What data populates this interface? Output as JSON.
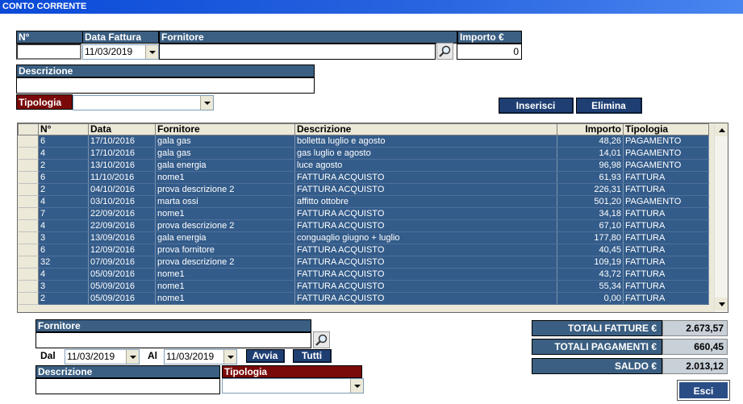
{
  "window": {
    "title": "CONTO CORRENTE"
  },
  "form": {
    "n_label": "N°",
    "n_value": "",
    "data_fattura_label": "Data Fattura",
    "data_fattura_value": "11/03/2019",
    "fornitore_label": "Fornitore",
    "fornitore_value": "",
    "importo_label": "Importo €",
    "importo_value": "0",
    "descrizione_label": "Descrizione",
    "descrizione_value": "",
    "tipologia_label": "Tipologia",
    "tipologia_value": ""
  },
  "actions": {
    "inserisci": "Inserisci",
    "elimina": "Elimina",
    "esci": "Esci"
  },
  "table": {
    "columns": [
      "N°",
      "Data",
      "Fornitore",
      "Descrizione",
      "Importo",
      "Tipologia"
    ],
    "rows": [
      [
        "6",
        "17/10/2016",
        "gala gas",
        "bolletta luglio e agosto",
        "48,26",
        "PAGAMENTO"
      ],
      [
        "4",
        "17/10/2016",
        "gala gas",
        "gas luglio e agosto",
        "14,01",
        "PAGAMENTO"
      ],
      [
        "2",
        "13/10/2016",
        "gala energia",
        "luce agosto",
        "96,98",
        "PAGAMENTO"
      ],
      [
        "6",
        "11/10/2016",
        "nome1",
        "FATTURA ACQUISTO",
        "61,93",
        "FATTURA"
      ],
      [
        "2",
        "04/10/2016",
        "prova descrizione 2",
        "FATTURA ACQUISTO",
        "226,31",
        "FATTURA"
      ],
      [
        "4",
        "03/10/2016",
        "marta ossi",
        "affitto ottobre",
        "501,20",
        "PAGAMENTO"
      ],
      [
        "7",
        "22/09/2016",
        "nome1",
        "FATTURA ACQUISTO",
        "34,18",
        "FATTURA"
      ],
      [
        "4",
        "22/09/2016",
        "prova descrizione 2",
        "FATTURA ACQUISTO",
        "67,10",
        "FATTURA"
      ],
      [
        "3",
        "13/09/2016",
        "gala energia",
        "conguaglio giugno + luglio",
        "177,80",
        "FATTURA"
      ],
      [
        "6",
        "12/09/2016",
        "prova fornitore",
        "FATTURA ACQUISTO",
        "40,45",
        "FATTURA"
      ],
      [
        "32",
        "07/09/2016",
        "prova descrizione 2",
        "FATTURA ACQUISTO",
        "109,19",
        "FATTURA"
      ],
      [
        "4",
        "05/09/2016",
        "nome1",
        "FATTURA ACQUISTO",
        "43,72",
        "FATTURA"
      ],
      [
        "3",
        "05/09/2016",
        "nome1",
        "FATTURA ACQUISTO",
        "55,34",
        "FATTURA"
      ],
      [
        "2",
        "05/09/2016",
        "nome1",
        "FATTURA ACQUISTO",
        "0,00",
        "FATTURA"
      ]
    ]
  },
  "filter": {
    "fornitore_label": "Fornitore",
    "fornitore_value": "",
    "dal_label": "Dal",
    "dal_value": "11/03/2019",
    "al_label": "Al",
    "al_value": "11/03/2019",
    "avvia": "Avvia",
    "tutti": "Tutti",
    "descrizione_label": "Descrizione",
    "descrizione_value": "",
    "tipologia_label": "Tipologia",
    "tipologia_value": ""
  },
  "totals": {
    "fatture_label": "TOTALI FATTURE €",
    "fatture_value": "2.673,57",
    "pagamenti_label": "TOTALI PAGAMENTI €",
    "pagamenti_value": "660,45",
    "saldo_label": "SALDO €",
    "saldo_value": "2.013,12"
  },
  "colors": {
    "label_blue": "#3b5f82",
    "label_red": "#7a0a0a",
    "row_blue": "#345c8a",
    "button_blue": "#1f3f73"
  },
  "icons": {
    "search": "search-icon",
    "dropdown": "chevron-down-icon"
  }
}
